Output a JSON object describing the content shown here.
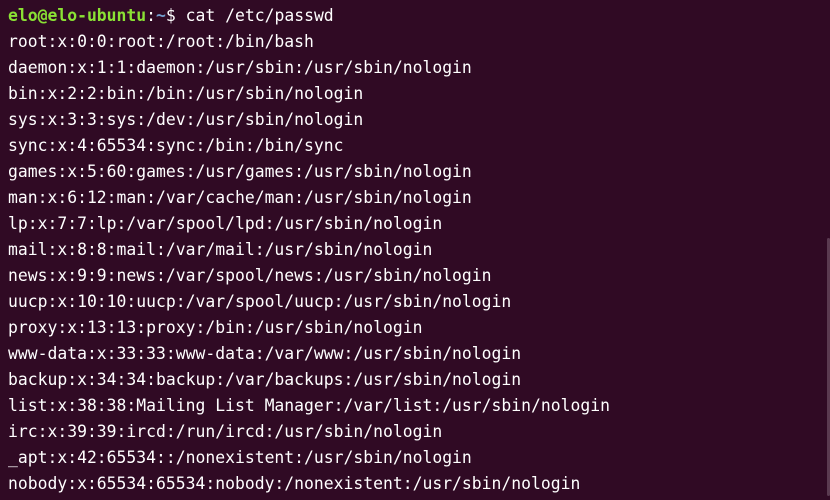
{
  "prompt": {
    "user_host": "elo@elo-ubuntu",
    "separator": ":",
    "path": "~",
    "sigil": "$ ",
    "command": "cat /etc/passwd"
  },
  "output_lines": [
    "root:x:0:0:root:/root:/bin/bash",
    "daemon:x:1:1:daemon:/usr/sbin:/usr/sbin/nologin",
    "bin:x:2:2:bin:/bin:/usr/sbin/nologin",
    "sys:x:3:3:sys:/dev:/usr/sbin/nologin",
    "sync:x:4:65534:sync:/bin:/bin/sync",
    "games:x:5:60:games:/usr/games:/usr/sbin/nologin",
    "man:x:6:12:man:/var/cache/man:/usr/sbin/nologin",
    "lp:x:7:7:lp:/var/spool/lpd:/usr/sbin/nologin",
    "mail:x:8:8:mail:/var/mail:/usr/sbin/nologin",
    "news:x:9:9:news:/var/spool/news:/usr/sbin/nologin",
    "uucp:x:10:10:uucp:/var/spool/uucp:/usr/sbin/nologin",
    "proxy:x:13:13:proxy:/bin:/usr/sbin/nologin",
    "www-data:x:33:33:www-data:/var/www:/usr/sbin/nologin",
    "backup:x:34:34:backup:/var/backups:/usr/sbin/nologin",
    "list:x:38:38:Mailing List Manager:/var/list:/usr/sbin/nologin",
    "irc:x:39:39:ircd:/run/ircd:/usr/sbin/nologin",
    "_apt:x:42:65534::/nonexistent:/usr/sbin/nologin",
    "nobody:x:65534:65534:nobody:/nonexistent:/usr/sbin/nologin"
  ],
  "colors": {
    "background": "#300a24",
    "user_host": "#8ae234",
    "path": "#729fcf",
    "text": "#ffffff"
  }
}
